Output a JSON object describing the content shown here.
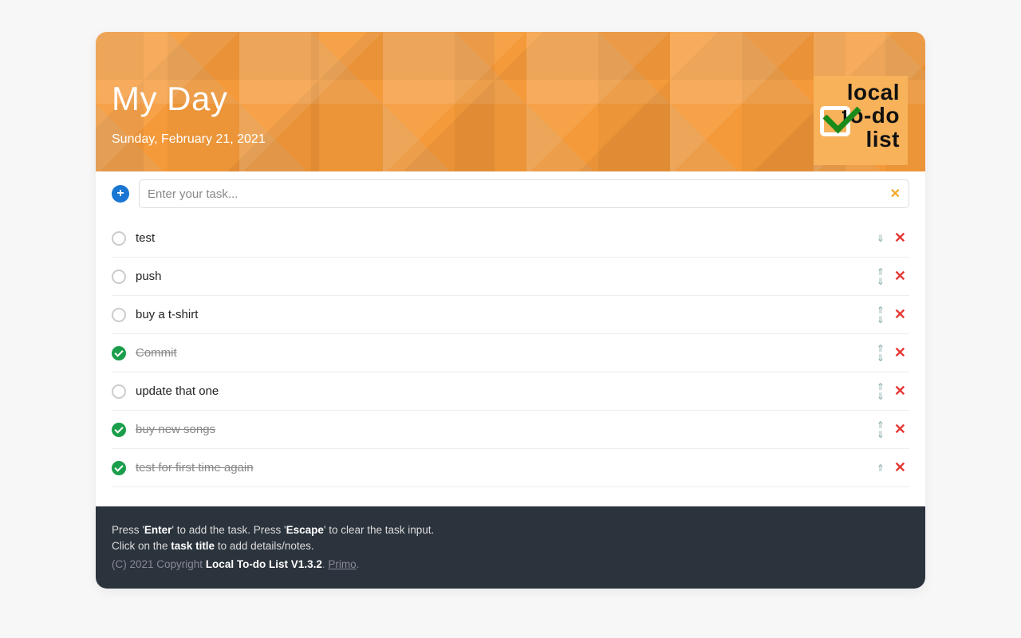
{
  "header": {
    "title": "My Day",
    "date": "Sunday, February 21, 2021",
    "logo_line1": "local",
    "logo_line2": "to-do",
    "logo_line3": "list"
  },
  "input": {
    "placeholder": "Enter your task..."
  },
  "tasks": [
    {
      "text": "test",
      "done": false,
      "up": false,
      "down": true
    },
    {
      "text": "push",
      "done": false,
      "up": true,
      "down": true
    },
    {
      "text": "buy a t-shirt",
      "done": false,
      "up": true,
      "down": true
    },
    {
      "text": "Commit",
      "done": true,
      "up": true,
      "down": true
    },
    {
      "text": "update that one",
      "done": false,
      "up": true,
      "down": true
    },
    {
      "text": "buy new songs",
      "done": true,
      "up": true,
      "down": true
    },
    {
      "text": "test for first time again",
      "done": true,
      "up": true,
      "down": false
    }
  ],
  "footer": {
    "help_prefix": "Press '",
    "enter": "Enter",
    "help_mid1": "' to add the task. Press '",
    "escape": "Escape",
    "help_suffix1": "' to clear the task input.",
    "detail_prefix": "Click on the ",
    "task_title": "task title",
    "detail_suffix": " to add details/notes.",
    "copy_prefix": "(C) 2021 Copyright ",
    "product": "Local To-do List V1.3.2",
    "dot": ". ",
    "author": "Primo",
    "dot2": "."
  }
}
